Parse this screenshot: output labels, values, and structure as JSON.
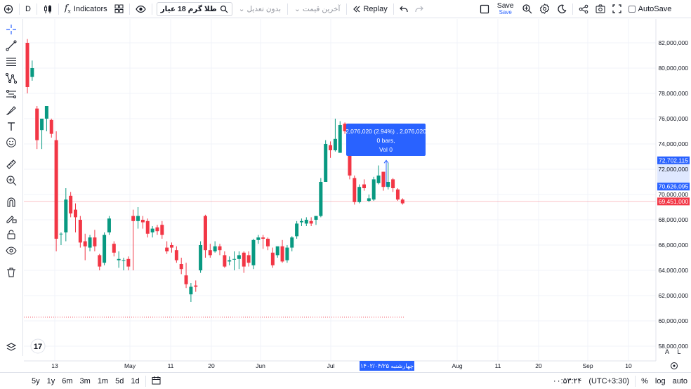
{
  "toolbar": {
    "interval": "D",
    "indicators_label": "Indicators",
    "symbol": "طلا گرم 18 عیار",
    "adjustment": "بدون تعدیل",
    "price_type": "آخرین قیمت",
    "replay_label": "Replay",
    "save_label": "Save",
    "save_sub_label": "Save",
    "autosave_label": "AutoSave"
  },
  "tooltip": {
    "line1": "2,076,020 (2.94%) , 2,076,020",
    "line2": "0 bars,",
    "line3": "Vol 0"
  },
  "price_axis": {
    "labels": [
      "82,000,000",
      "80,000,000",
      "78,000,000",
      "76,000,000",
      "74,000,000",
      "72,000,000",
      "70,000,000",
      "68,000,000",
      "66,000,000",
      "64,000,000",
      "62,000,000",
      "60,000,000",
      "58,000,000"
    ],
    "badge_top": "72,702,115",
    "badge_bottom": "70,626,095",
    "badge_last": "69,451,000",
    "scale_a": "A",
    "scale_l": "L"
  },
  "time_axis": {
    "labels": [
      "13",
      "May",
      "11",
      "20",
      "Jun",
      "Jul",
      "Aug",
      "11",
      "20",
      "Sep",
      "10"
    ],
    "cursor_label": "چهارشنبه ۱۴۰۲/۰۴/۲۵"
  },
  "bottombar": {
    "ranges": [
      "5y",
      "1y",
      "6m",
      "3m",
      "1m",
      "5d",
      "1d"
    ],
    "clock": "۰۰:۵۳:۲۴",
    "timezone": "(UTC+3:30)",
    "percent": "%",
    "log": "log",
    "auto": "auto"
  },
  "colors": {
    "up": "#089981",
    "down": "#f23645",
    "accent": "#2962ff",
    "last_price": "#f23645"
  },
  "chart_data": {
    "type": "candlestick",
    "ylim": [
      57500000,
      83000000
    ],
    "last_price": 69451000,
    "measure_from": 70626095,
    "measure_to": 72702115,
    "dotted_level": 60300000,
    "candles": [
      {
        "o": 82000000,
        "h": 82300000,
        "l": 78000000,
        "c": 78500000
      },
      {
        "o": 79300000,
        "h": 80600000,
        "l": 79000000,
        "c": 80000000
      },
      {
        "o": 76800000,
        "h": 77000000,
        "l": 73600000,
        "c": 74300000
      },
      {
        "o": 75100000,
        "h": 75200000,
        "l": 73600000,
        "c": 76000000
      },
      {
        "o": 76000000,
        "h": 77000000,
        "l": 75000000,
        "c": 77000000
      },
      {
        "o": 75900000,
        "h": 76000000,
        "l": 74500000,
        "c": 74800000
      },
      {
        "o": 74300000,
        "h": 75000000,
        "l": 65500000,
        "c": 66500000
      },
      {
        "o": 66900000,
        "h": 67000000,
        "l": 66000000,
        "c": 66900000
      },
      {
        "o": 67000000,
        "h": 70500000,
        "l": 66300000,
        "c": 69600000
      },
      {
        "o": 69900000,
        "h": 70200000,
        "l": 68200000,
        "c": 68500000
      },
      {
        "o": 68800000,
        "h": 69300000,
        "l": 67000000,
        "c": 68200000
      },
      {
        "o": 68000000,
        "h": 68300000,
        "l": 65800000,
        "c": 66200000
      },
      {
        "o": 66300000,
        "h": 66900000,
        "l": 64800000,
        "c": 65900000
      },
      {
        "o": 65800000,
        "h": 66800000,
        "l": 65500000,
        "c": 66600000
      },
      {
        "o": 66600000,
        "h": 67200000,
        "l": 65500000,
        "c": 65900000
      },
      {
        "o": 65200000,
        "h": 65300000,
        "l": 64000000,
        "c": 64300000
      },
      {
        "o": 64600000,
        "h": 67000000,
        "l": 64400000,
        "c": 66800000
      },
      {
        "o": 67000000,
        "h": 68300000,
        "l": 66800000,
        "c": 68100000
      },
      {
        "o": 66100000,
        "h": 66300000,
        "l": 65100000,
        "c": 65400000
      },
      {
        "o": 64800000,
        "h": 65500000,
        "l": 64200000,
        "c": 64900000
      },
      {
        "o": 64800000,
        "h": 65000000,
        "l": 64000000,
        "c": 64800000
      },
      {
        "o": 64900000,
        "h": 65100000,
        "l": 64000000,
        "c": 64300000
      },
      {
        "o": 68300000,
        "h": 68800000,
        "l": 64000000,
        "c": 67900000
      },
      {
        "o": 67900000,
        "h": 69000000,
        "l": 67300000,
        "c": 68300000
      },
      {
        "o": 68000000,
        "h": 68300000,
        "l": 67300000,
        "c": 67800000
      },
      {
        "o": 67900000,
        "h": 68100000,
        "l": 66600000,
        "c": 66900000
      },
      {
        "o": 67000000,
        "h": 67500000,
        "l": 66600000,
        "c": 67300000
      },
      {
        "o": 67400000,
        "h": 67600000,
        "l": 66800000,
        "c": 67100000
      },
      {
        "o": 67600000,
        "h": 67900000,
        "l": 66500000,
        "c": 66800000
      },
      {
        "o": 65800000,
        "h": 66300000,
        "l": 65300000,
        "c": 65500000
      },
      {
        "o": 66000000,
        "h": 66200000,
        "l": 65400000,
        "c": 65800000
      },
      {
        "o": 65600000,
        "h": 65900000,
        "l": 64600000,
        "c": 64800000
      },
      {
        "o": 64500000,
        "h": 65000000,
        "l": 63700000,
        "c": 64100000
      },
      {
        "o": 63600000,
        "h": 64600000,
        "l": 62600000,
        "c": 62900000
      },
      {
        "o": 62100000,
        "h": 63000000,
        "l": 61500000,
        "c": 62700000
      },
      {
        "o": 62800000,
        "h": 63200000,
        "l": 62300000,
        "c": 62700000
      },
      {
        "o": 64000000,
        "h": 66300000,
        "l": 63800000,
        "c": 66000000
      },
      {
        "o": 68300000,
        "h": 68400000,
        "l": 65000000,
        "c": 65600000
      },
      {
        "o": 65600000,
        "h": 66100000,
        "l": 65000000,
        "c": 65200000
      },
      {
        "o": 65500000,
        "h": 66300000,
        "l": 65400000,
        "c": 65900000
      },
      {
        "o": 65900000,
        "h": 66100000,
        "l": 65200000,
        "c": 65600000
      },
      {
        "o": 65200000,
        "h": 65500000,
        "l": 64200000,
        "c": 64300000
      },
      {
        "o": 64700000,
        "h": 65100000,
        "l": 64400000,
        "c": 64800000
      },
      {
        "o": 64900000,
        "h": 65500000,
        "l": 64000000,
        "c": 64900000
      },
      {
        "o": 64900000,
        "h": 65500000,
        "l": 64100000,
        "c": 65200000
      },
      {
        "o": 65400000,
        "h": 65500000,
        "l": 63800000,
        "c": 64300000
      },
      {
        "o": 65200000,
        "h": 65500000,
        "l": 64300000,
        "c": 64600000
      },
      {
        "o": 64400000,
        "h": 66500000,
        "l": 64100000,
        "c": 66400000
      },
      {
        "o": 66400000,
        "h": 66800000,
        "l": 66100000,
        "c": 66600000
      },
      {
        "o": 66600000,
        "h": 66800000,
        "l": 65700000,
        "c": 66500000
      },
      {
        "o": 66500000,
        "h": 66600000,
        "l": 65600000,
        "c": 65900000
      },
      {
        "o": 65400000,
        "h": 65800000,
        "l": 64200000,
        "c": 64400000
      },
      {
        "o": 65200000,
        "h": 65600000,
        "l": 65000000,
        "c": 65900000
      },
      {
        "o": 65900000,
        "h": 66400000,
        "l": 64600000,
        "c": 64700000
      },
      {
        "o": 64800000,
        "h": 66000000,
        "l": 64600000,
        "c": 65800000
      },
      {
        "o": 65800000,
        "h": 66700000,
        "l": 65500000,
        "c": 66600000
      },
      {
        "o": 66700000,
        "h": 67900000,
        "l": 66500000,
        "c": 67700000
      },
      {
        "o": 67800000,
        "h": 68100000,
        "l": 67500000,
        "c": 67900000
      },
      {
        "o": 67700000,
        "h": 68200000,
        "l": 67500000,
        "c": 68000000
      },
      {
        "o": 67900000,
        "h": 68200000,
        "l": 67500000,
        "c": 67700000
      },
      {
        "o": 68000000,
        "h": 68300000,
        "l": 67600000,
        "c": 68300000
      },
      {
        "o": 68300000,
        "h": 71300000,
        "l": 68200000,
        "c": 71000000
      },
      {
        "o": 71000000,
        "h": 74300000,
        "l": 71000000,
        "c": 74000000
      },
      {
        "o": 73900000,
        "h": 74200000,
        "l": 72900000,
        "c": 73500000
      },
      {
        "o": 73500000,
        "h": 76000000,
        "l": 73400000,
        "c": 74400000
      },
      {
        "o": 73300000,
        "h": 75800000,
        "l": 73300000,
        "c": 75500000
      },
      {
        "o": 75600000,
        "h": 75700000,
        "l": 74800000,
        "c": 75000000
      },
      {
        "o": 74200000,
        "h": 74500000,
        "l": 71200000,
        "c": 71500000
      },
      {
        "o": 71300000,
        "h": 71500000,
        "l": 69200000,
        "c": 69400000
      },
      {
        "o": 69400000,
        "h": 70800000,
        "l": 69300000,
        "c": 70600000
      },
      {
        "o": 70800000,
        "h": 71200000,
        "l": 70300000,
        "c": 70500000
      },
      {
        "o": 69500000,
        "h": 70000000,
        "l": 69400000,
        "c": 69700000
      },
      {
        "o": 69600000,
        "h": 71400000,
        "l": 69500000,
        "c": 71200000
      },
      {
        "o": 70900000,
        "h": 72300000,
        "l": 70800000,
        "c": 71500000
      },
      {
        "o": 71800000,
        "h": 71800000,
        "l": 70300000,
        "c": 70600000
      },
      {
        "o": 70600000,
        "h": 72500000,
        "l": 70400000,
        "c": 71000000
      },
      {
        "o": 71200000,
        "h": 71300000,
        "l": 70200000,
        "c": 70500000
      },
      {
        "o": 70400000,
        "h": 70500000,
        "l": 69500000,
        "c": 69600000
      },
      {
        "o": 69600000,
        "h": 69700000,
        "l": 69200000,
        "c": 69300000
      }
    ]
  }
}
